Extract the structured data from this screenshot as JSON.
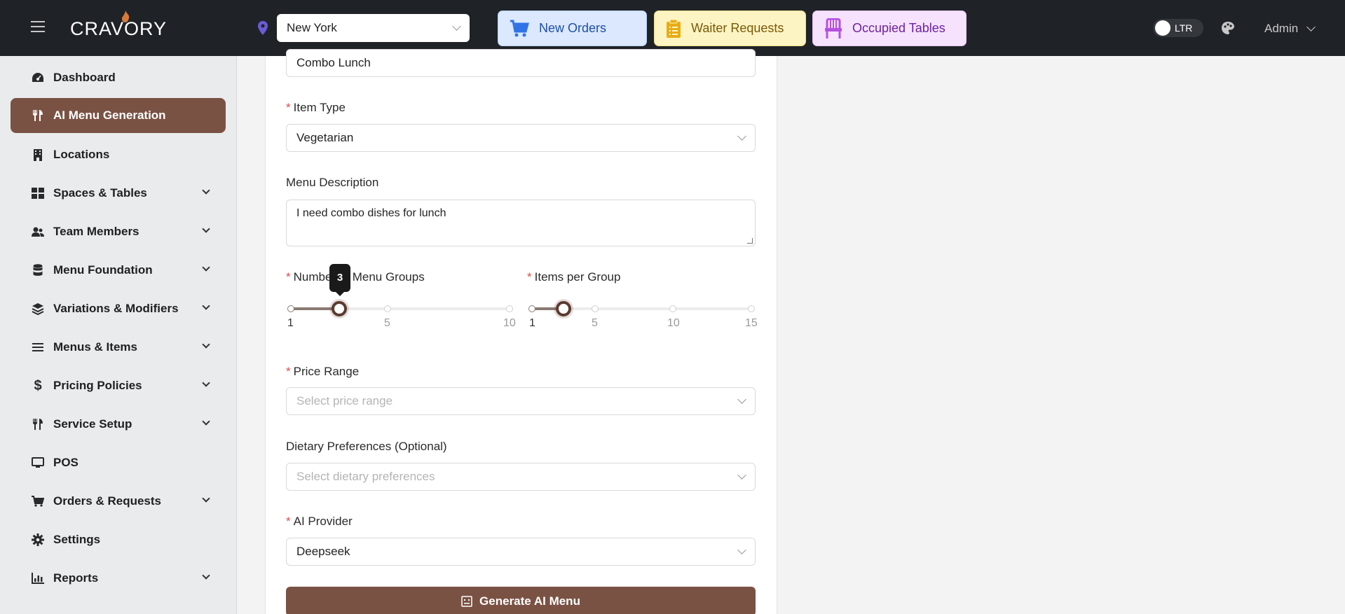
{
  "header": {
    "brand": "CRAVORY",
    "location_value": "New York",
    "quick_buttons": {
      "new_orders": "New Orders",
      "waiter_requests": "Waiter Requests",
      "occupied_tables": "Occupied Tables"
    },
    "direction_toggle": "LTR",
    "user": "Admin"
  },
  "sidebar": {
    "items": [
      {
        "label": "Dashboard",
        "icon": "gauge-icon",
        "expandable": false
      },
      {
        "label": "AI Menu Generation",
        "icon": "utensils-icon",
        "expandable": false,
        "active": true
      },
      {
        "label": "Locations",
        "icon": "building-icon",
        "expandable": false
      },
      {
        "label": "Spaces & Tables",
        "icon": "grid-icon",
        "expandable": true
      },
      {
        "label": "Team Members",
        "icon": "users-icon",
        "expandable": true
      },
      {
        "label": "Menu Foundation",
        "icon": "database-icon",
        "expandable": true
      },
      {
        "label": "Variations & Modifiers",
        "icon": "layers-icon",
        "expandable": true
      },
      {
        "label": "Menus & Items",
        "icon": "list-icon",
        "expandable": true
      },
      {
        "label": "Pricing Policies",
        "icon": "dollar-icon",
        "expandable": true
      },
      {
        "label": "Service Setup",
        "icon": "utensils-icon",
        "expandable": true
      },
      {
        "label": "POS",
        "icon": "monitor-icon",
        "expandable": false
      },
      {
        "label": "Orders & Requests",
        "icon": "cart-icon",
        "expandable": true
      },
      {
        "label": "Settings",
        "icon": "gear-icon",
        "expandable": false
      },
      {
        "label": "Reports",
        "icon": "chart-icon",
        "expandable": true
      }
    ]
  },
  "form": {
    "menu_name_value": "Combo Lunch",
    "item_type": {
      "label": "Item Type",
      "value": "Vegetarian"
    },
    "menu_description": {
      "label": "Menu Description",
      "value": "I need combo dishes for lunch"
    },
    "menu_groups": {
      "label": "Number of Menu Groups",
      "value": 3,
      "min": 1,
      "max": 10,
      "marks": [
        "1",
        "5",
        "10"
      ],
      "tooltip": "3"
    },
    "items_per_group": {
      "label": "Items per Group",
      "value": 3,
      "min": 1,
      "max": 15,
      "marks": [
        "1",
        "5",
        "10",
        "15"
      ]
    },
    "price_range": {
      "label": "Price Range",
      "placeholder": "Select price range"
    },
    "dietary": {
      "label": "Dietary Preferences (Optional)",
      "placeholder": "Select dietary preferences"
    },
    "ai_provider": {
      "label": "AI Provider",
      "value": "Deepseek"
    },
    "generate_button": "Generate AI Menu"
  }
}
